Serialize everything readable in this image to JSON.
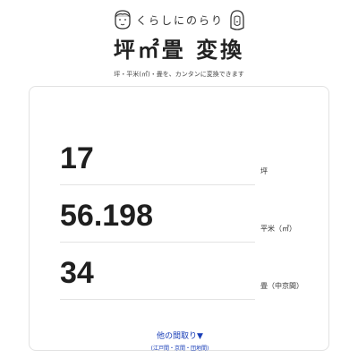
{
  "header": {
    "tagline": "くらしにのらり",
    "title": "坪㎡畳 変換",
    "subtitle": "坪・平米(㎡)・畳を、カンタンに変換できます"
  },
  "rows": [
    {
      "value": "17",
      "unit": "坪"
    },
    {
      "value": "56.198",
      "unit": "平米（㎡）"
    },
    {
      "value": "34",
      "unit": "畳（中京間）"
    }
  ],
  "more": {
    "label": "他の間取り▼",
    "sub": "(江戸間・京間・団地間)"
  }
}
